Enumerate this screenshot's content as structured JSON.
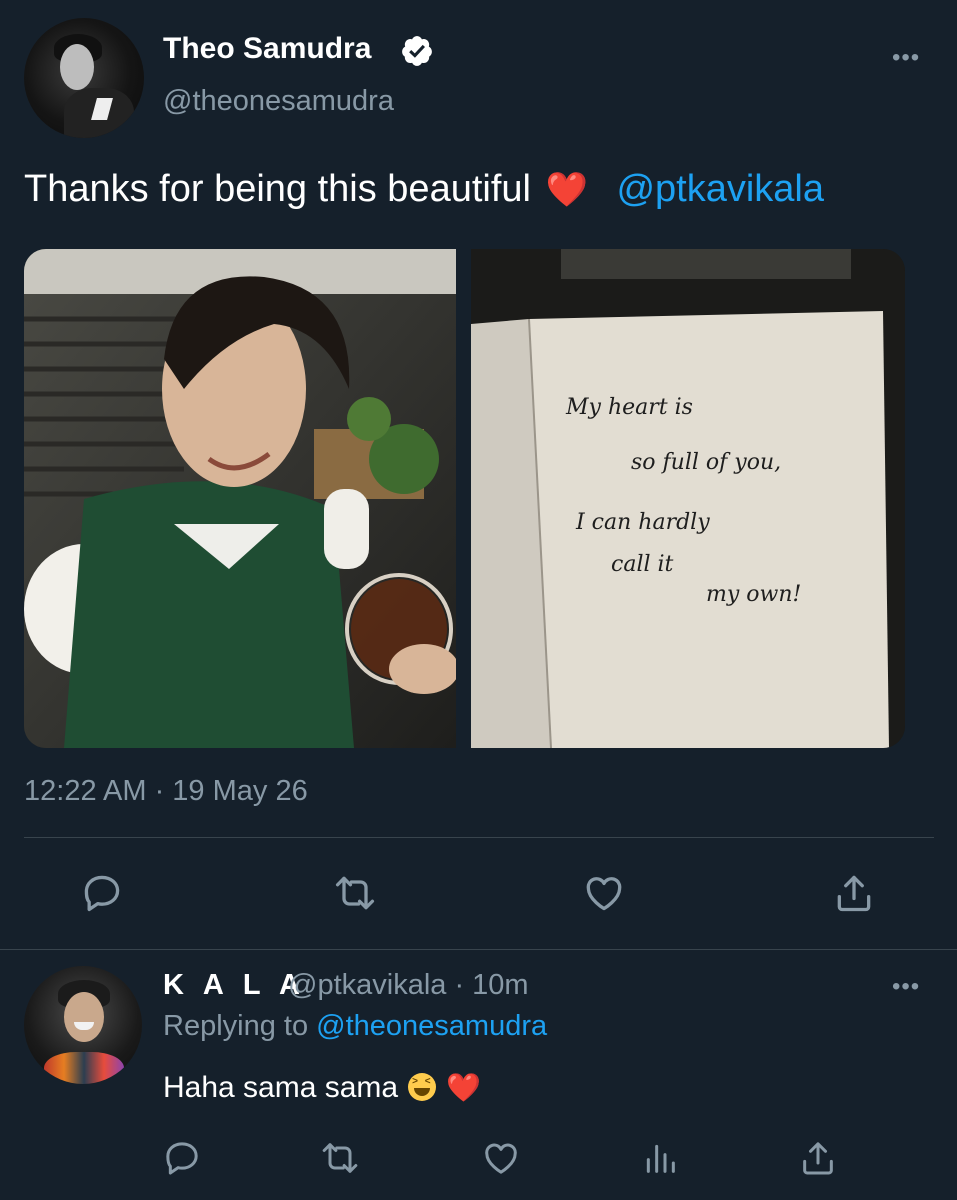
{
  "tweet": {
    "author_name": "Theo Samudra",
    "author_handle": "@theonesamudra",
    "text": "Thanks for being this beautiful",
    "heart_emoji": "❤️",
    "mention": "@ptkavikala",
    "timestamp": "12:22 AM · 19 May 26",
    "more_label": "•••",
    "card_note_lines": [
      "My heart is",
      "so full of you,",
      "I can hardly",
      "call it",
      "my own!"
    ]
  },
  "actions": [
    "reply-icon",
    "retweet-icon",
    "like-icon",
    "share-icon"
  ],
  "reply": {
    "author_name": "K A L A",
    "author_handle": "@ptkavikala · 10m",
    "replying_prefix": "Replying to ",
    "replying_to": "@theonesamudra",
    "text": "Haha sama sama",
    "heart_emoji": "❤️",
    "more_label": "•••",
    "actions": [
      "reply-icon",
      "retweet-icon",
      "like-icon",
      "analytics-icon",
      "share-icon"
    ]
  },
  "colors": {
    "background": "#15202b",
    "secondary_text": "#8899a6",
    "accent": "#1da1f2",
    "heart": "#e0245e",
    "divider": "#38444d"
  }
}
